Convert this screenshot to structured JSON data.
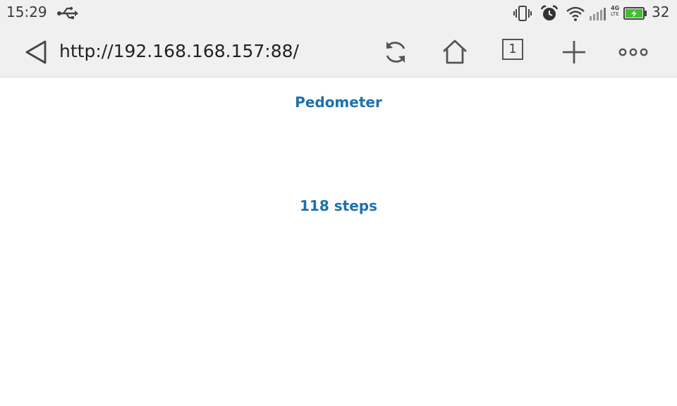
{
  "status_bar": {
    "time": "15:29",
    "battery_level": "32",
    "network_label_top": "4G",
    "network_label_bottom": "LTE",
    "icons": [
      "usb-icon",
      "vibrate-icon",
      "alarm-icon",
      "wifi-icon",
      "signal-icon",
      "battery-icon"
    ],
    "battery_color": "#3fbf2f"
  },
  "browser": {
    "url": "http://192.168.168.157:88/",
    "tab_count": "1",
    "icons": [
      "back-icon",
      "refresh-icon",
      "home-icon",
      "tabs-icon",
      "new-tab-icon",
      "more-icon"
    ]
  },
  "page": {
    "title": "Pedometer",
    "steps": "118 steps",
    "accent_color": "#1d71ad"
  }
}
